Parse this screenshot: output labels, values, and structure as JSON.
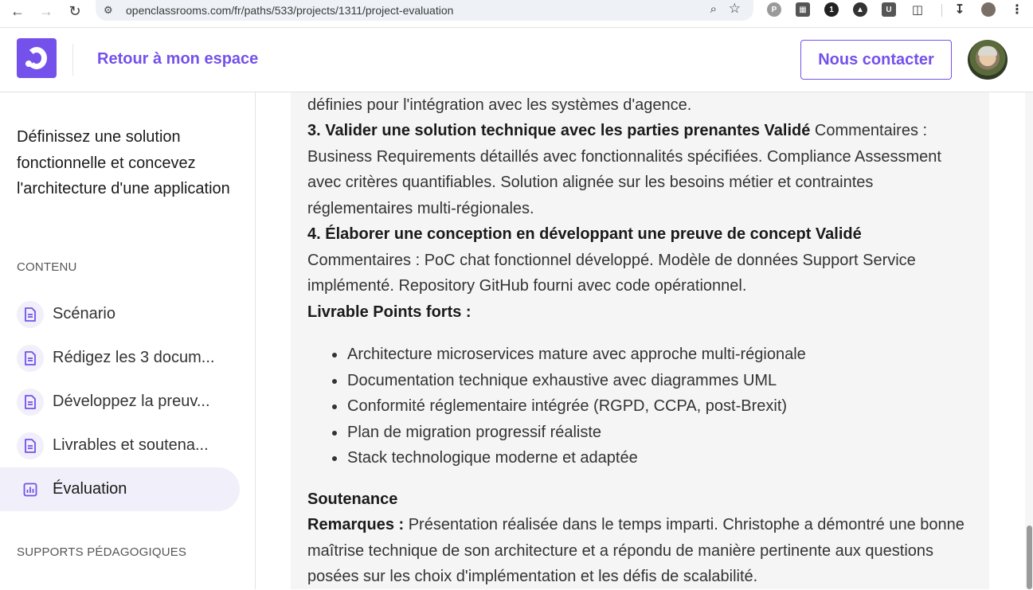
{
  "browser": {
    "url": "openclassrooms.com/fr/paths/533/projects/1311/project-evaluation"
  },
  "header": {
    "back_label": "Retour à mon espace",
    "contact_label": "Nous contacter"
  },
  "sidebar": {
    "title": "Définissez une solution fonctionnelle et concevez l'architecture d'une application",
    "contents_label": "CONTENU",
    "items": [
      {
        "label": "Scénario",
        "icon": "document-icon",
        "active": false
      },
      {
        "label": "Rédigez les 3 docum...",
        "icon": "document-icon",
        "active": false
      },
      {
        "label": "Développez la preuv...",
        "icon": "document-icon",
        "active": false
      },
      {
        "label": "Livrables et soutena...",
        "icon": "document-icon",
        "active": false
      },
      {
        "label": "Évaluation",
        "icon": "chart-icon",
        "active": true
      }
    ],
    "supports_label": "SUPPORTS PÉDAGOGIQUES"
  },
  "main": {
    "line_top": "définies pour l'intégration avec les systèmes d'agence.",
    "item3": {
      "heading": "3. Valider une solution technique avec les parties prenantes Validé",
      "comment": "Commentaires : Business Requirements détaillés avec fonctionnalités spécifiées. Compliance Assessment avec critères quantifiables. Solution alignée sur les besoins métier et contraintes réglementaires multi-régionales."
    },
    "item4": {
      "heading": "4. Élaborer une conception en développant une preuve de concept Validé",
      "comment": "Commentaires : PoC chat fonctionnel développé. Modèle de données Support Service implémenté. Repository GitHub fourni avec code opérationnel."
    },
    "strengths_heading": "Livrable Points forts :",
    "strengths": [
      "Architecture microservices mature avec approche multi-régionale",
      "Documentation technique exhaustive avec diagrammes UML",
      "Conformité réglementaire intégrée (RGPD, CCPA, post-Brexit)",
      "Plan de migration progressif réaliste",
      "Stack technologique moderne et adaptée"
    ],
    "defense_heading": "Soutenance",
    "remarks_label": "Remarques :",
    "remarks_text": " Présentation réalisée dans le temps imparti. Christophe a démontré une bonne maîtrise technique de son architecture et a répondu de manière pertinente aux questions posées sur les choix d'implémentation et les défis de scalabilité."
  },
  "colors": {
    "brand": "#7451eb",
    "panel": "#f5f5f5",
    "active_bg": "#f0effa"
  }
}
